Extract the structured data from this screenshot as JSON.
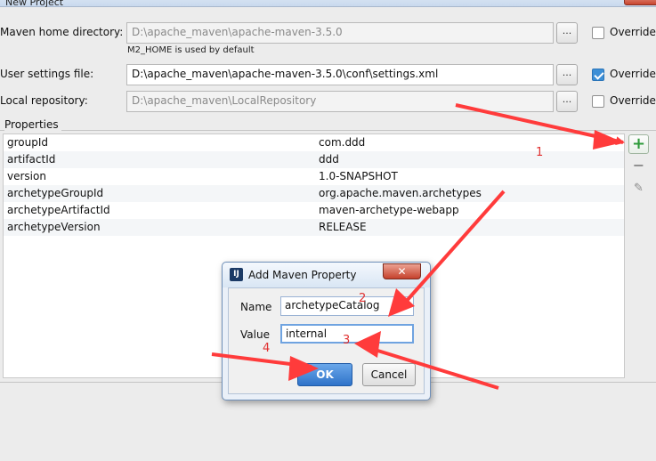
{
  "window": {
    "title": "New Project"
  },
  "maven_home": {
    "label": "Maven home directory:",
    "value": "D:\\apache_maven\\apache-maven-3.5.0",
    "hint": "M2_HOME is used by default",
    "browse": "...",
    "override_label": "Override",
    "override_checked": false
  },
  "user_settings": {
    "label": "User settings file:",
    "value": "D:\\apache_maven\\apache-maven-3.5.0\\conf\\settings.xml",
    "browse": "...",
    "override_label": "Override",
    "override_checked": true
  },
  "local_repo": {
    "label": "Local repository:",
    "value": "D:\\apache_maven\\LocalRepository",
    "browse": "...",
    "override_label": "Override",
    "override_checked": false
  },
  "properties": {
    "title": "Properties",
    "rows": [
      {
        "key": "groupId",
        "value": "com.ddd"
      },
      {
        "key": "artifactId",
        "value": "ddd"
      },
      {
        "key": "version",
        "value": "1.0-SNAPSHOT"
      },
      {
        "key": "archetypeGroupId",
        "value": "org.apache.maven.archetypes"
      },
      {
        "key": "archetypeArtifactId",
        "value": "maven-archetype-webapp"
      },
      {
        "key": "archetypeVersion",
        "value": "RELEASE"
      }
    ],
    "add_icon": "plus-icon",
    "remove_icon": "minus-icon",
    "edit_icon": "pencil-icon"
  },
  "dialog": {
    "title": "Add Maven Property",
    "icon_text": "IJ",
    "close_glyph": "✕",
    "name_label": "Name",
    "name_value": "archetypeCatalog",
    "value_label": "Value",
    "value_value": "internal",
    "ok_label": "OK",
    "cancel_label": "Cancel"
  },
  "annotations": {
    "n1": "1",
    "n2": "2",
    "n3": "3",
    "n4": "4",
    "color": "#e03030"
  },
  "glyphs": {
    "plus": "+",
    "minus": "−",
    "pencil": "✎"
  }
}
